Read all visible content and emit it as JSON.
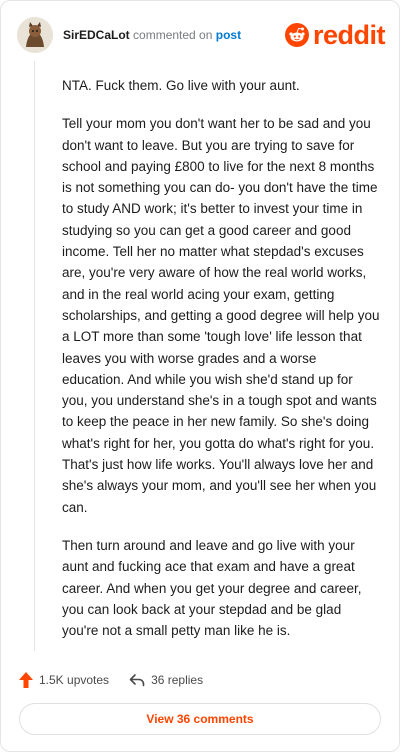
{
  "header": {
    "username": "SirEDCaLot",
    "commented_text": "commented on",
    "post_link": "post",
    "logo_text": "reddit"
  },
  "comment": {
    "paragraphs": [
      "NTA. Fuck them. Go live with your aunt.",
      "Tell your mom you don't want her to be sad and you don't want to leave. But you are trying to save for school and paying £800 to live for the next 8 months is not something you can do- you don't have the time to study AND work; it's better to invest your time in studying so you can get a good career and good income. Tell her no matter what stepdad's excuses are, you're very aware of how the real world works, and in the real world acing your exam, getting scholarships, and getting a good degree will help you a LOT more than some 'tough love' life lesson that leaves you with worse grades and a worse education. And while you wish she'd stand up for you, you understand she's in a tough spot and wants to keep the peace in her new family. So she's doing what's right for her, you gotta do what's right for you. That's just how life works. You'll always love her and she's always your mom, and you'll see her when you can.",
      "Then turn around and leave and go live with your aunt and fucking ace that exam and have a great career. And when you get your degree and career, you can look back at your stepdad and be glad you're not a small petty man like he is."
    ]
  },
  "actions": {
    "upvotes": "1.5K upvotes",
    "replies": "36 replies"
  },
  "view_comments": "View 36 comments",
  "colors": {
    "brand": "#ff4500",
    "link": "#0079d3"
  }
}
